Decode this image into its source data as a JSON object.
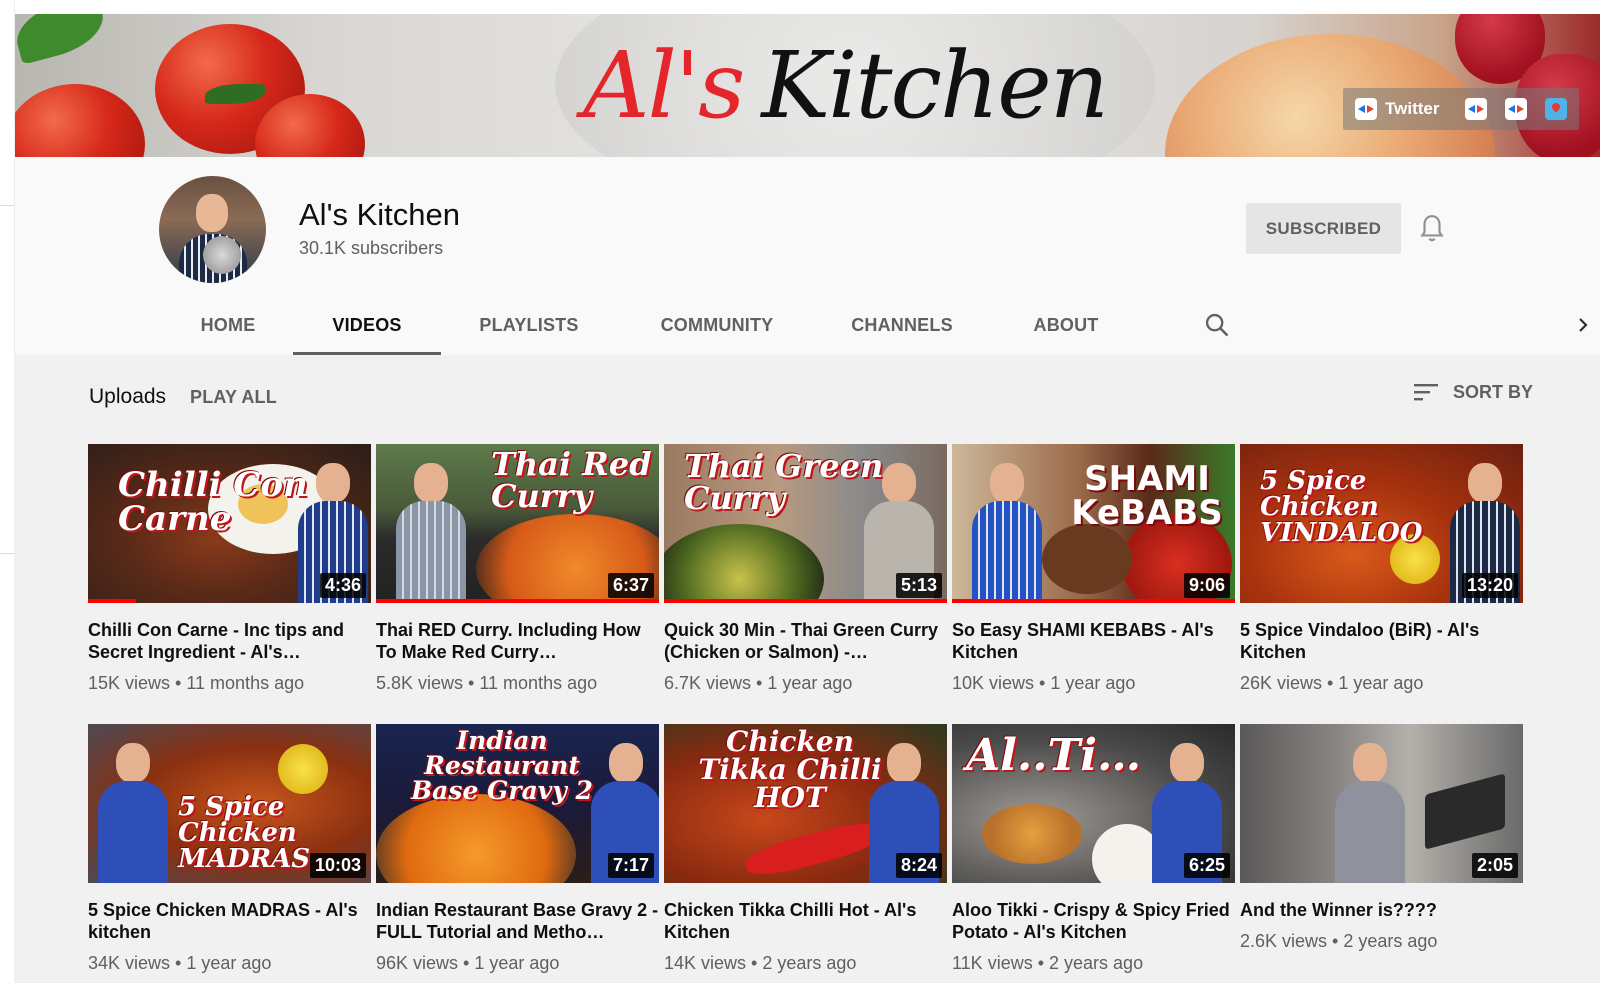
{
  "banner": {
    "title_part1": "Al's",
    "title_part2": "Kitchen",
    "links": [
      {
        "label": "Twitter",
        "icon": "link-favicon-icon"
      },
      {
        "label": "",
        "icon": "link-favicon-icon"
      },
      {
        "label": "",
        "icon": "link-favicon-icon"
      },
      {
        "label": "",
        "icon": "location-pin-icon"
      }
    ]
  },
  "channel": {
    "name": "Al's Kitchen",
    "subscribers": "30.1K subscribers",
    "subscribe_label": "SUBSCRIBED"
  },
  "tabs": [
    "HOME",
    "VIDEOS",
    "PLAYLISTS",
    "COMMUNITY",
    "CHANNELS",
    "ABOUT"
  ],
  "active_tab": "VIDEOS",
  "section": {
    "title": "Uploads",
    "play_all": "PLAY ALL",
    "sort_by": "SORT BY"
  },
  "videos": [
    {
      "title": "Chilli Con Carne - Inc tips and Secret Ingredient - Al's…",
      "views": "15K views",
      "age": "11 months ago",
      "duration": "4:36",
      "thumb_text": "Chilli Con Carne",
      "watched": 0.17
    },
    {
      "title": "Thai RED Curry. Including How To Make Red Curry…",
      "views": "5.8K views",
      "age": "11 months ago",
      "duration": "6:37",
      "thumb_text": "Thai Red Curry",
      "watched": 1.0
    },
    {
      "title": "Quick 30 Min - Thai Green Curry (Chicken or Salmon) -…",
      "views": "6.7K views",
      "age": "1 year ago",
      "duration": "5:13",
      "thumb_text": "Thai Green Curry",
      "watched": 1.0
    },
    {
      "title": "So Easy SHAMI KEBABS - Al's Kitchen",
      "views": "10K views",
      "age": "1 year ago",
      "duration": "9:06",
      "thumb_text": "SHAMI KeBABS",
      "watched": 1.0
    },
    {
      "title": "5 Spice Vindaloo (BiR) - Al's Kitchen",
      "views": "26K views",
      "age": "1 year ago",
      "duration": "13:20",
      "thumb_text": "5 Spice Chicken VINDALOO",
      "watched": 0
    },
    {
      "title": "5 Spice Chicken MADRAS - Al's kitchen",
      "views": "34K views",
      "age": "1 year ago",
      "duration": "10:03",
      "thumb_text": "5 Spice Chicken MADRAS",
      "watched": 0
    },
    {
      "title": "Indian Restaurant Base Gravy 2 - FULL Tutorial and Metho…",
      "views": "96K views",
      "age": "1 year ago",
      "duration": "7:17",
      "thumb_text": "Indian Restaurant Base Gravy 2",
      "watched": 0
    },
    {
      "title": "Chicken Tikka Chilli Hot - Al's Kitchen",
      "views": "14K views",
      "age": "2 years ago",
      "duration": "8:24",
      "thumb_text": "Chicken Tikka Chilli HOT",
      "watched": 0
    },
    {
      "title": "Aloo Tikki - Crispy & Spicy Fried Potato - Al's Kitchen",
      "views": "11K views",
      "age": "2 years ago",
      "duration": "6:25",
      "thumb_text": "Al..Ti…",
      "watched": 0
    },
    {
      "title": "And the Winner is????",
      "views": "2.6K views",
      "age": "2 years ago",
      "duration": "2:05",
      "thumb_text": "",
      "watched": 0
    }
  ],
  "colors": {
    "accent": "#ff0000",
    "banner_red": "#e4252c"
  }
}
